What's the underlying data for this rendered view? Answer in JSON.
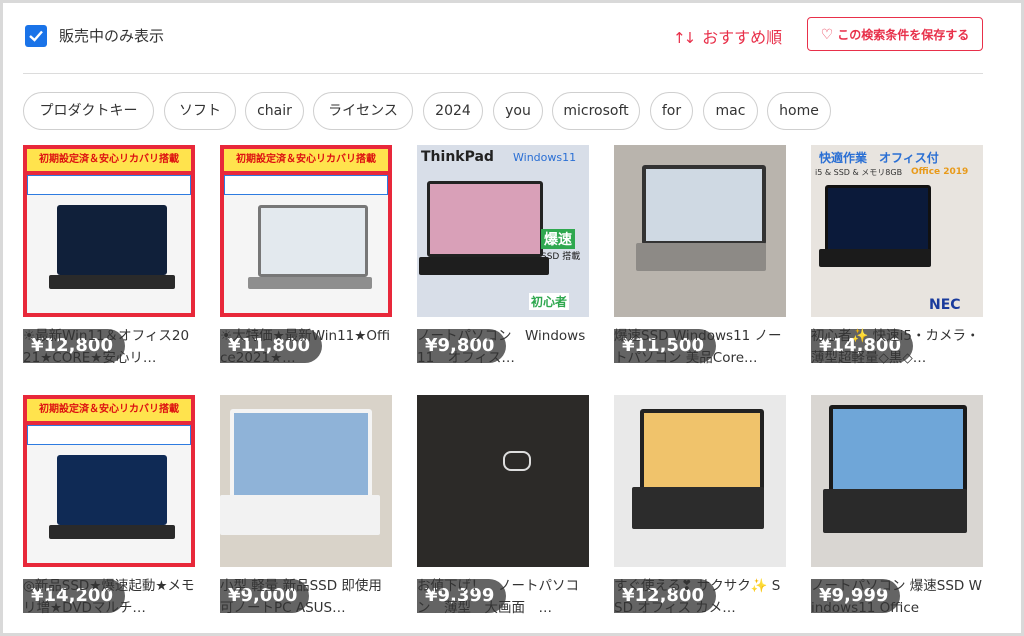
{
  "filter": {
    "checked": true,
    "label": "販売中のみ表示"
  },
  "sort": {
    "icon": "sort-arrows-icon",
    "label": "おすすめ順"
  },
  "save_button": {
    "label": "この検索条件を保存する",
    "icon": "heart-icon"
  },
  "chips": [
    "プロダクトキー",
    "ソフト",
    "chair",
    "ライセンス",
    "2024",
    "you",
    "microsoft",
    "for",
    "mac",
    "home"
  ],
  "items": [
    {
      "price": "¥12,800",
      "title": "☀最新Win11＆オフィス2021★CORE★安心リ…"
    },
    {
      "price": "¥11,800",
      "title": "☀大特価★最新Win11★Office2021★…"
    },
    {
      "price": "¥9,800",
      "title": "ノートパソコン　Windows11　オフィス…"
    },
    {
      "price": "¥11,500",
      "title": "爆速SSD Windows11 ノートパソコン 美品Core…"
    },
    {
      "price": "¥14,800",
      "title": "初心者✨ 快速i5・カメラ・薄型超軽量◇黒◇…"
    },
    {
      "price": "¥14,200",
      "title": "◎新品SSD★爆速起動★メモリ増★DVDマルチ…"
    },
    {
      "price": "¥9,000",
      "title": "小型 軽量 新品SSD 即使用可ノートPC ASUS…"
    },
    {
      "price": "¥9,399",
      "title": "お値下げ！　ノートパソコン　薄型　大画面　…"
    },
    {
      "price": "¥12,800",
      "title": "すぐ使える❣ サクサク✨ SSD オフィス カメ…"
    },
    {
      "price": "¥9,999",
      "title": "ノートパソコン 爆速SSD Windows11 Office"
    }
  ],
  "thumb_text": {
    "banner": "初期設定済＆安心リカバリ搭載",
    "thinkpad": "ThinkPad",
    "windows11": "Windows11",
    "bakusoku": "爆速",
    "ssd": "SSD 搭載",
    "shoshinsha": "初心者",
    "kaiteki": "快適作業　オフィス付",
    "office2019": "Office 2019",
    "spec": "i5 & SSD & メモリ8GB",
    "nec": "NEC"
  },
  "colors": {
    "accent": "#e8304a",
    "checkbox": "#1a73e8"
  }
}
